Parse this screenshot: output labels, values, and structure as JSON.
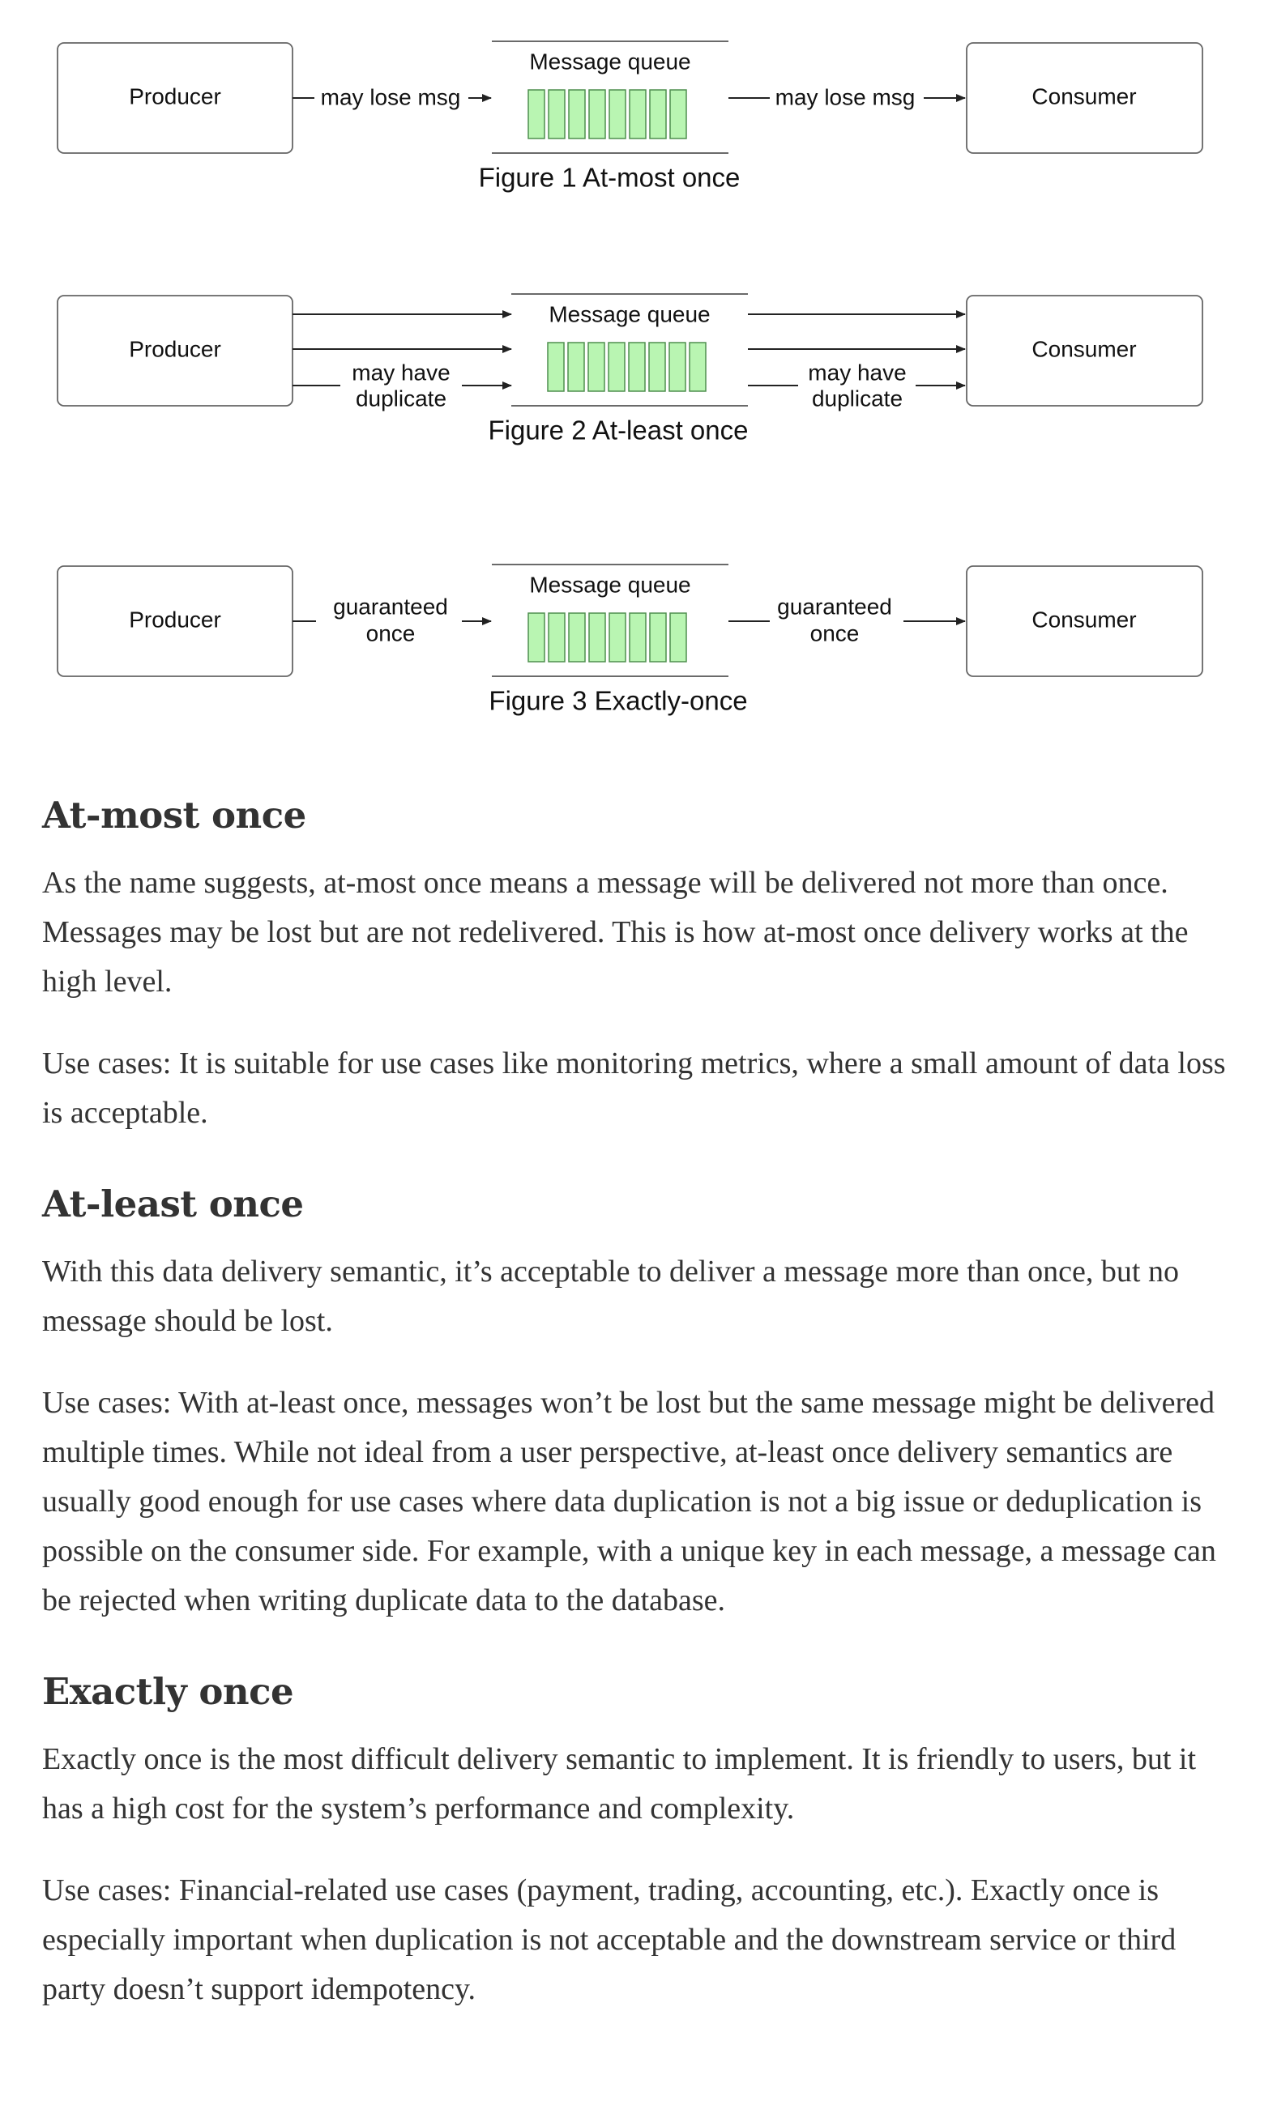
{
  "figures": [
    {
      "caption": "Figure 1 At-most once",
      "producer": "Producer",
      "consumer": "Consumer",
      "queue_label": "Message queue",
      "left_label": "may lose msg",
      "right_label": "may lose msg"
    },
    {
      "caption": "Figure 2 At-least once",
      "producer": "Producer",
      "consumer": "Consumer",
      "queue_label": "Message queue",
      "left_label_line1": "may have",
      "left_label_line2": "duplicate",
      "right_label_line1": "may have",
      "right_label_line2": "duplicate"
    },
    {
      "caption": "Figure 3 Exactly-once",
      "producer": "Producer",
      "consumer": "Consumer",
      "queue_label": "Message queue",
      "left_label_line1": "guaranteed",
      "left_label_line2": "once",
      "right_label_line1": "guaranteed",
      "right_label_line2": "once"
    }
  ],
  "sections": [
    {
      "heading": "At-most once",
      "paragraphs": [
        "As the name suggests, at-most once means a message will be delivered not more than once. Messages may be lost but are not redelivered. This is how at-most once delivery works at the high level.",
        "Use cases: It is suitable for use cases like monitoring metrics, where a small amount of data loss is acceptable."
      ]
    },
    {
      "heading": "At-least once",
      "paragraphs": [
        "With this data delivery semantic, it’s acceptable to deliver a message more than once, but no message should be lost.",
        "Use cases: With at-least once, messages won’t be lost but the same message might be delivered multiple times. While not ideal from a user perspective, at-least once delivery semantics are usually good enough for use cases where data duplication is not a big issue or deduplication is possible on the consumer side. For example, with a unique key in each message, a message can be rejected when writing duplicate data to the database."
      ]
    },
    {
      "heading": "Exactly once",
      "paragraphs": [
        "Exactly once is the most difficult delivery semantic to implement. It is friendly to users, but it has a high cost for the system’s performance and complexity.",
        "Use cases: Financial-related use cases (payment, trading, accounting, etc.). Exactly once is especially important when duplication is not acceptable and the downstream service or third party doesn’t support idempotency."
      ]
    }
  ],
  "colors": {
    "queue_cell_fill": "#b9f5b2",
    "queue_cell_stroke": "#4f8f4f",
    "text": "#333333"
  }
}
